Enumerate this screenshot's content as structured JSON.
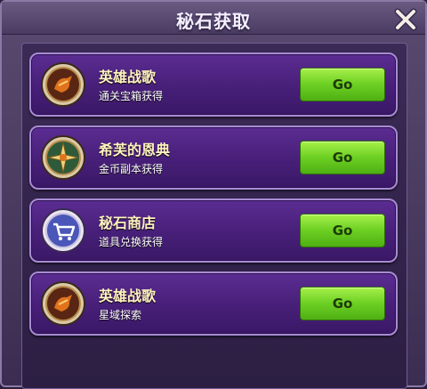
{
  "dialog": {
    "title": "秘石获取",
    "close_icon": "close-x-icon"
  },
  "rows": [
    {
      "name": "英雄战歌",
      "desc": "通关宝箱获得",
      "button": "Go",
      "icon": "hero-emblem-icon"
    },
    {
      "name": "希芙的恩典",
      "desc": "金币副本获得",
      "button": "Go",
      "icon": "compass-star-icon"
    },
    {
      "name": "秘石商店",
      "desc": "道具兑换获得",
      "button": "Go",
      "icon": "shop-cart-icon"
    },
    {
      "name": "英雄战歌",
      "desc": "星域探索",
      "button": "Go",
      "icon": "hero-emblem-icon"
    }
  ],
  "colors": {
    "go_button": "#6ccf23",
    "card_bg": "#471f78",
    "title_text": "#f4f0ff"
  }
}
